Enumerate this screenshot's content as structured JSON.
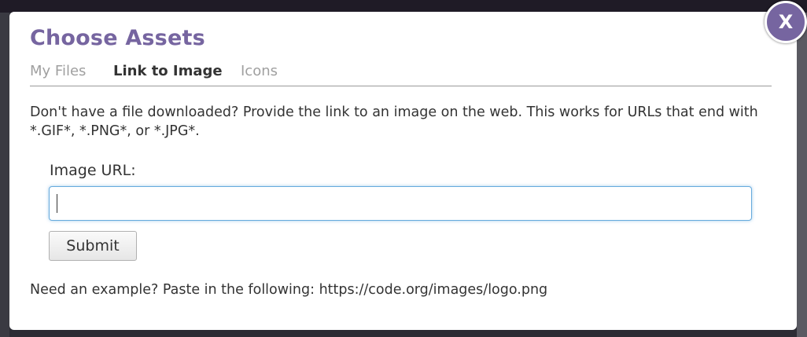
{
  "dialog": {
    "title": "Choose Assets",
    "tabs": [
      {
        "label": "My Files",
        "active": false
      },
      {
        "label": "Link to Image",
        "active": true
      },
      {
        "label": "Icons",
        "active": false
      }
    ],
    "description": "Don't have a file downloaded? Provide the link to an image on the web. This works for URLs that end with *.GIF*, *.PNG*, or *.JPG*.",
    "url_label": "Image URL:",
    "url_value": "",
    "submit_label": "Submit",
    "example_text": "Need an example? Paste in the following: https://code.org/images/logo.png",
    "close_label": "X"
  },
  "colors": {
    "accent": "#7665a0",
    "text": "#333333",
    "inactive_tab": "#a0a0a0",
    "input_focus": "#66aadd"
  },
  "icons": {
    "close": "close-icon"
  }
}
